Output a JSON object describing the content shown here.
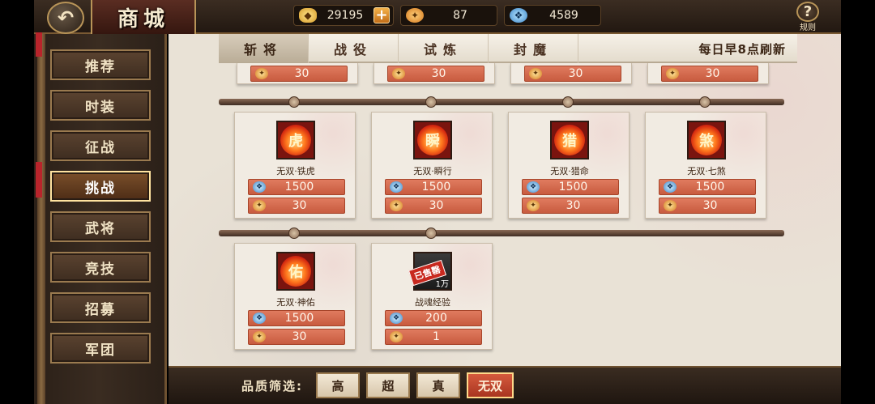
{
  "header": {
    "back_icon": "back-arrow-icon",
    "title": "商城",
    "currencies": [
      {
        "icon": "gold-ingot-icon",
        "value": "29195",
        "has_plus": true
      },
      {
        "icon": "token-icon",
        "value": "87"
      },
      {
        "icon": "jade-icon",
        "value": "4589"
      }
    ],
    "rules_label": "规则",
    "rules_symbol": "?"
  },
  "sidebar": {
    "items": [
      {
        "label": "推荐"
      },
      {
        "label": "时装"
      },
      {
        "label": "征战"
      },
      {
        "label": "挑战",
        "active": true
      },
      {
        "label": "武将"
      },
      {
        "label": "竞技"
      },
      {
        "label": "招募"
      },
      {
        "label": "军团"
      }
    ]
  },
  "tabs": {
    "items": [
      {
        "label": "斩将",
        "active": true
      },
      {
        "label": "战役"
      },
      {
        "label": "试炼"
      },
      {
        "label": "封魔"
      }
    ],
    "refresh_note": "每日早8点刷新"
  },
  "partial_row": {
    "prices": [
      "30",
      "30",
      "30",
      "30"
    ]
  },
  "cards": [
    {
      "name": "无双·铁虎",
      "glyph": "虎",
      "jade_price": "1500",
      "token_price": "30"
    },
    {
      "name": "无双·瞬行",
      "glyph": "瞬",
      "jade_price": "1500",
      "token_price": "30"
    },
    {
      "name": "无双·猎命",
      "glyph": "猎",
      "jade_price": "1500",
      "token_price": "30"
    },
    {
      "name": "无双·七煞",
      "glyph": "煞",
      "jade_price": "1500",
      "token_price": "30"
    },
    {
      "name": "无双·神佑",
      "glyph": "佑",
      "jade_price": "1500",
      "token_price": "30"
    },
    {
      "name": "战魂经验",
      "sold_label": "已售罄",
      "amount": "1万",
      "jade_price": "200",
      "token_price": "1"
    }
  ],
  "filter": {
    "label": "品质筛选:",
    "options": [
      {
        "label": "高"
      },
      {
        "label": "超"
      },
      {
        "label": "真"
      },
      {
        "label": "无双",
        "active": true
      }
    ]
  },
  "colors": {
    "price_bar": "#c85b3f",
    "active_accent": "#ffe3a0",
    "panel_bg": "#e9e2d6"
  }
}
